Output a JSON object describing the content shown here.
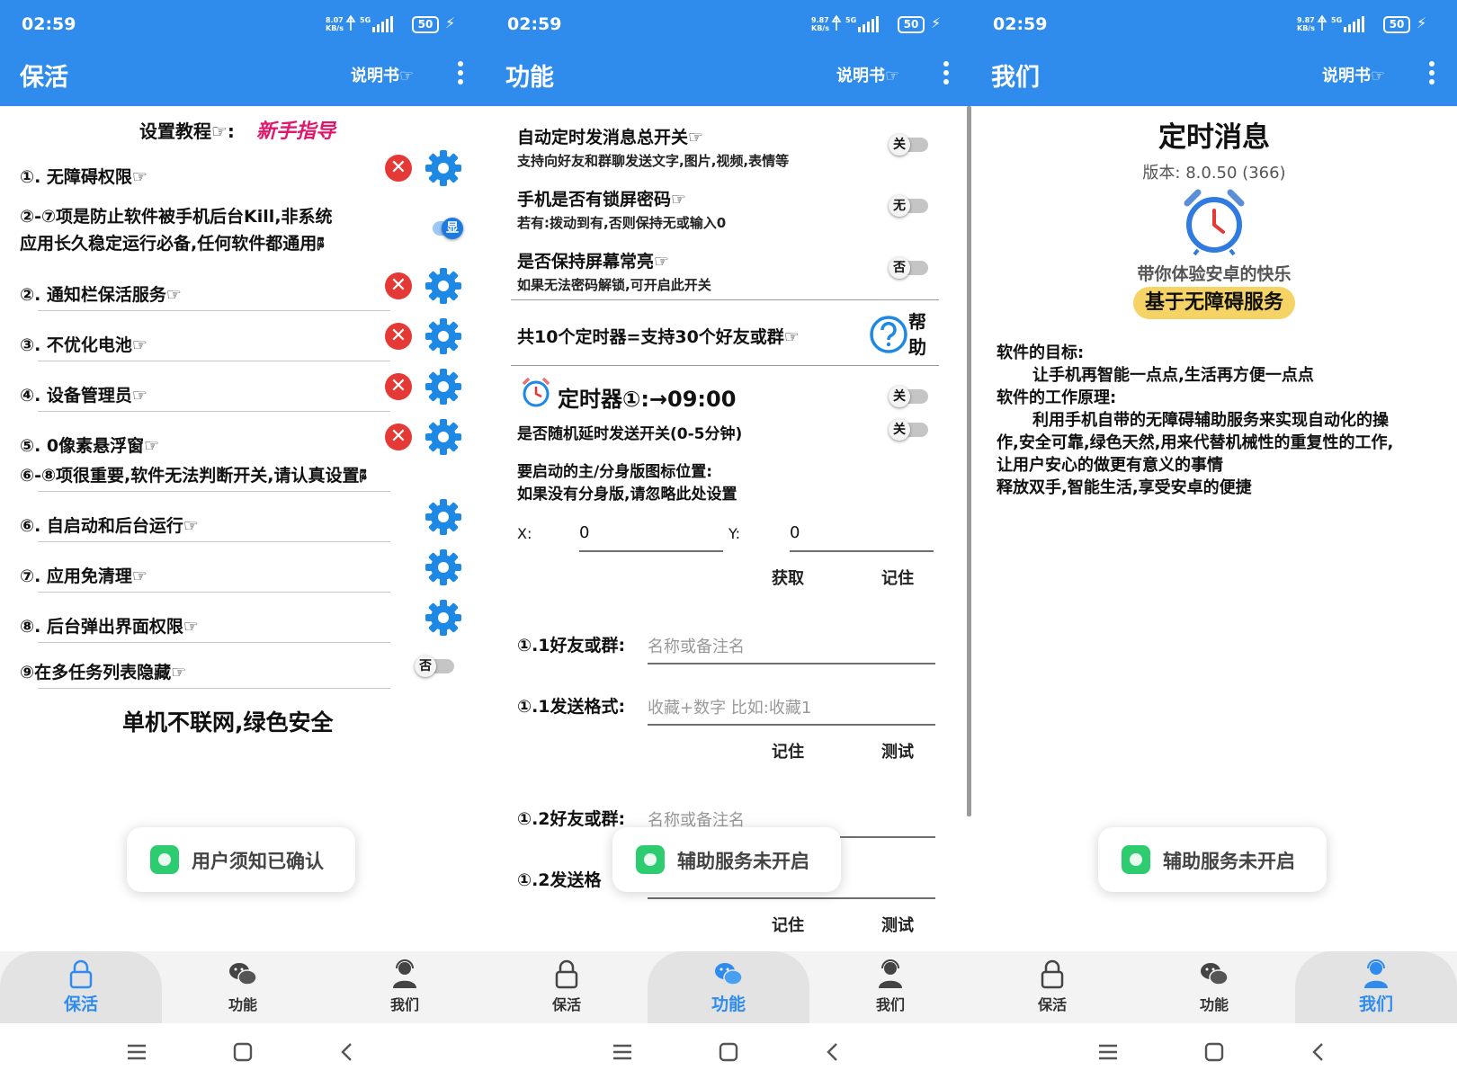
{
  "status": {
    "time": "02:59",
    "net_speed_top": "8.07",
    "net_speed_top_p2": "9.87",
    "net_speed_unit": "KB/s",
    "network": "5G",
    "battery": "50"
  },
  "panel1": {
    "title": "保活",
    "manual": "说明书☞",
    "tutorial_prefix": "设置教程☞:",
    "tutorial_link": "新手指导",
    "items": [
      {
        "label": "①. 无障碍权限☞"
      },
      {
        "label": "②. 通知栏保活服务☞"
      },
      {
        "label": "③. 不优化电池☞"
      },
      {
        "label": "④. 设备管理员☞"
      },
      {
        "label": "⑤. 0像素悬浮窗☞"
      },
      {
        "label": "⑥. 自启动和后台运行☞"
      },
      {
        "label": "⑦. 应用免清理☞"
      },
      {
        "label": "⑧. 后台弹出界面权限☞"
      },
      {
        "label": "⑨在多任务列表隐藏☞"
      }
    ],
    "note_line1": "②-⑦项是防止软件被手机后台Kill,非系统",
    "note_line2": "应用长久稳定运行必备,任何软件都通用🖗",
    "note2": "⑥-⑧项很重要,软件无法判断开关,请认真设置🖗",
    "toggle_show": "显",
    "toggle_hide": "否",
    "footer": "单机不联网,绿色安全",
    "toast": "用户须知已确认"
  },
  "panel2": {
    "title": "功能",
    "manual": "说明书☞",
    "s1_title": "自动定时发消息总开关☞",
    "s1_sub": "支持向好友和群聊发送文字,图片,视频,表情等",
    "s1_toggle": "关",
    "s2_title": "手机是否有锁屏密码☞",
    "s2_sub": "若有:拨动到有,否则保持无或输入0",
    "s2_toggle": "无",
    "s3_title": "是否保持屏幕常亮☞",
    "s3_sub": "如果无法密码解锁,可开启此开关",
    "s3_toggle": "否",
    "timers_text": "共10个定时器=支持30个好友或群☞",
    "help": "帮助",
    "help_1": "帮",
    "help_2": "助",
    "timer_title": "定时器①:→09:00",
    "timer_toggle": "关",
    "random_label": "是否随机延时发送开关(0-5分钟)",
    "random_toggle": "关",
    "pos_line1": "要启动的主/分身版图标位置:",
    "pos_line2": "如果没有分身版,请忽略此处设置",
    "x_label": "X:",
    "x_value": "0",
    "y_label": "Y:",
    "y_value": "0",
    "get_btn": "获取",
    "remember_btn": "记住",
    "f11_label": "①.1好友或群:",
    "f11_placeholder": "名称或备注名",
    "f12_label": "①.1发送格式:",
    "f12_placeholder": "收藏+数字 比如:收藏1",
    "remember_btn2": "记住",
    "test_btn": "测试",
    "f21_label": "①.2好友或群:",
    "f21_placeholder": "名称或备注名",
    "f22_label": "①.2发送格",
    "remember_btn3": "记住",
    "test_btn2": "测试",
    "toast": "辅助服务未开启"
  },
  "panel3": {
    "title": "我们",
    "manual": "说明书☞",
    "app_name": "定时消息",
    "version": "版本: 8.0.50 (366)",
    "slogan": "带你体验安卓的快乐",
    "badge": "基于无障碍服务",
    "goal_title": "软件的目标:",
    "goal_text": "让手机再智能一点点,生活再方便一点点",
    "principle_title": "软件的工作原理:",
    "principle_l1": "利用手机自带的无障碍辅助服务来实现自动化的操",
    "principle_l2": "作,安全可靠,绿色天然,用来代替机械性的重复性的工作,",
    "principle_l3": "让用户安心的做更有意义的事情",
    "principle_l4": "释放双手,智能生活,享受安卓的便捷",
    "toast": "辅助服务未开启"
  },
  "tabs": [
    "保活",
    "功能",
    "我们"
  ],
  "colors": {
    "primary": "#2f8cec",
    "accent_pink": "#e0186c",
    "badge_yellow": "#f6d365",
    "danger": "#e53935"
  },
  "icons": [
    "lock-icon",
    "wechat-icon",
    "support-agent-icon",
    "gear-icon",
    "close-icon",
    "alarm-clock-icon",
    "help-icon",
    "menu-icon",
    "home-icon",
    "back-icon"
  ]
}
